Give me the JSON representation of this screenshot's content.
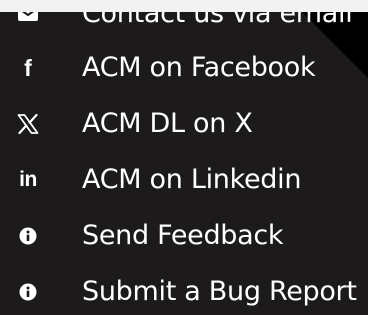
{
  "menu": {
    "items": [
      {
        "label": "Contact us via email",
        "icon": "email-icon"
      },
      {
        "label": "ACM on Facebook",
        "icon": "facebook-icon"
      },
      {
        "label": "ACM DL on X",
        "icon": "x-icon"
      },
      {
        "label": "ACM on Linkedin",
        "icon": "linkedin-icon"
      },
      {
        "label": "Send Feedback",
        "icon": "info-icon"
      },
      {
        "label": "Submit a Bug Report",
        "icon": "info-icon"
      }
    ]
  },
  "colors": {
    "background": "#1c1a1a",
    "text": "#ffffff",
    "top_strip": "#f2f2f2",
    "corner_shade": "#000000"
  }
}
